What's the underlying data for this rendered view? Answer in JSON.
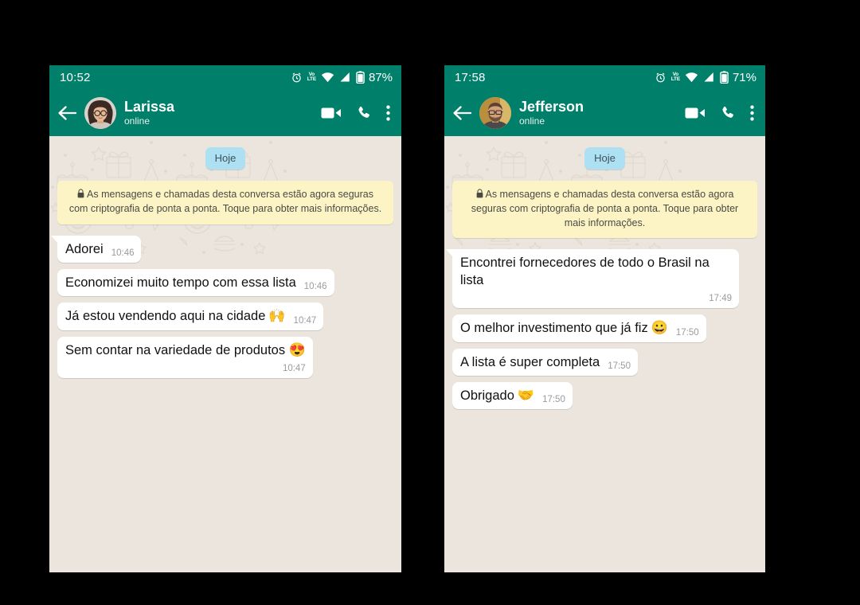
{
  "phones": [
    {
      "id": "left",
      "status_bar": {
        "clock": "10:52",
        "battery_percent": "87%",
        "icons": [
          "alarm-clock-icon",
          "volte-icon",
          "wifi-icon",
          "cellular-signal-icon",
          "battery-icon"
        ],
        "volte_top": "Vo",
        "volte_bottom": "LTE"
      },
      "app_bar": {
        "back_label": "back-arrow-icon",
        "contact_name": "Larissa",
        "contact_status": "online",
        "video_call_label": "video-call-icon",
        "voice_call_label": "voice-call-icon",
        "overflow_label": "overflow-menu-icon"
      },
      "chat": {
        "date_chip": "Hoje",
        "encryption_notice": "As mensagens e chamadas desta conversa estão agora seguras com criptografia de ponta a ponta. Toque para obter mais informações.",
        "messages": [
          {
            "text": "Adorei",
            "emoji": "",
            "time": "10:46",
            "tail": true,
            "time_below": false,
            "width": "auto"
          },
          {
            "text": "Economizei muito tempo com essa lista",
            "emoji": "",
            "time": "10:46",
            "tail": false,
            "time_below": false,
            "width": "auto"
          },
          {
            "text": "Já estou vendendo aqui na cidade",
            "emoji": "🙌",
            "time": "10:47",
            "tail": false,
            "time_below": false,
            "width": "auto"
          },
          {
            "text": "Sem contar na variedade de produtos",
            "emoji": "😍",
            "time": "10:47",
            "tail": false,
            "time_below": true,
            "width": "auto"
          }
        ]
      }
    },
    {
      "id": "right",
      "status_bar": {
        "clock": "17:58",
        "battery_percent": "71%",
        "icons": [
          "alarm-clock-icon",
          "volte-icon",
          "wifi-icon",
          "cellular-signal-icon",
          "battery-icon"
        ],
        "volte_top": "Vo",
        "volte_bottom": "LTE"
      },
      "app_bar": {
        "back_label": "back-arrow-icon",
        "contact_name": "Jefferson",
        "contact_status": "online",
        "video_call_label": "video-call-icon",
        "voice_call_label": "voice-call-icon",
        "overflow_label": "overflow-menu-icon"
      },
      "chat": {
        "date_chip": "Hoje",
        "encryption_notice": "As mensagens e chamadas desta conversa estão agora seguras com criptografia de ponta a ponta. Toque para obter mais informações.",
        "messages": [
          {
            "text": "Encontrei fornecedores de todo o Brasil na lista",
            "emoji": "",
            "time": "17:49",
            "tail": true,
            "time_below": true,
            "width": "auto"
          },
          {
            "text": "O melhor investimento que já fiz",
            "emoji": "😀",
            "time": "17:50",
            "tail": false,
            "time_below": false,
            "width": "auto"
          },
          {
            "text": "A lista é super completa",
            "emoji": "",
            "time": "17:50",
            "tail": false,
            "time_below": false,
            "width": "auto"
          },
          {
            "text": "Obrigado",
            "emoji": "🤝",
            "time": "17:50",
            "tail": false,
            "time_below": false,
            "width": "auto"
          }
        ]
      }
    }
  ],
  "colors": {
    "header_green": "#00806a",
    "chat_background": "#ece5dd",
    "bubble_white": "#ffffff",
    "date_chip_blue": "#ace0f2",
    "encryption_yellow": "#fdf4c5",
    "page_background": "#000000",
    "timestamp_grey": "#9b9b9b"
  }
}
